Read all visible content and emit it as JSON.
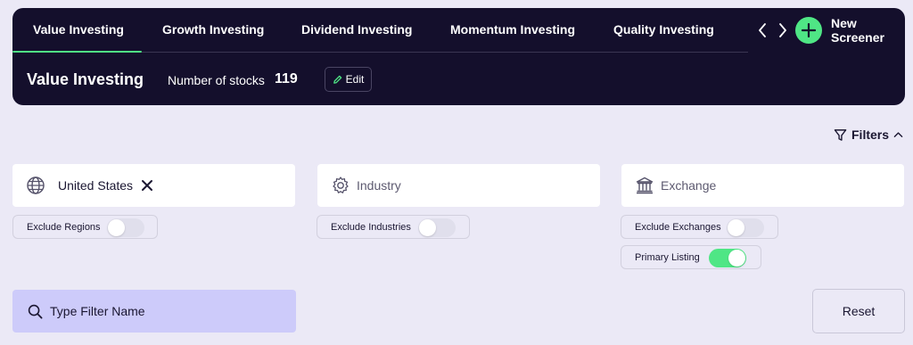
{
  "tabs": [
    {
      "label": "Value Investing",
      "active": true
    },
    {
      "label": "Growth Investing",
      "active": false
    },
    {
      "label": "Dividend Investing",
      "active": false
    },
    {
      "label": "Momentum Investing",
      "active": false
    },
    {
      "label": "Quality Investing",
      "active": false
    }
  ],
  "new_screener_label_line1": "New",
  "new_screener_label_line2": "Screener",
  "screener": {
    "name": "Value Investing",
    "stocks_label": "Number of stocks",
    "stocks_count": "119",
    "edit_label": "Edit"
  },
  "filters_label": "Filters",
  "filters": {
    "region": {
      "value": "United States",
      "toggle_label": "Exclude Regions",
      "toggle_on": false
    },
    "industry": {
      "placeholder": "Industry",
      "toggle_label": "Exclude Industries",
      "toggle_on": false
    },
    "exchange": {
      "placeholder": "Exchange",
      "toggle_label": "Exclude Exchanges",
      "toggle_on": false,
      "primary_label": "Primary Listing",
      "primary_on": true
    }
  },
  "search": {
    "placeholder": "Type Filter Name"
  },
  "reset_label": "Reset",
  "colors": {
    "panel": "#140f2c",
    "accent": "#4fe685",
    "background": "#ebe9f6",
    "search_bg": "#cdcbfa"
  },
  "icons": [
    "chevron-left-icon",
    "chevron-right-icon",
    "plus-icon",
    "pencil-icon",
    "funnel-icon",
    "chevron-up-icon",
    "globe-icon",
    "close-icon",
    "gear-icon",
    "bank-icon",
    "search-icon"
  ]
}
